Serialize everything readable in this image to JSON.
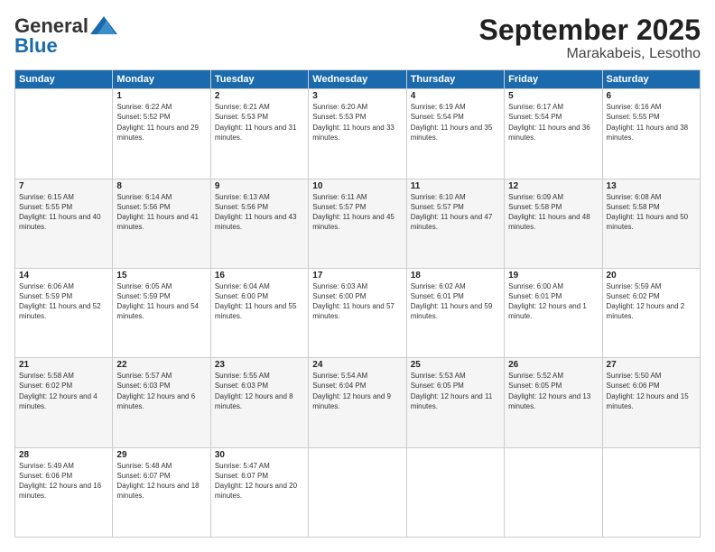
{
  "header": {
    "logo_general": "General",
    "logo_blue": "Blue",
    "month_title": "September 2025",
    "location": "Marakabeis, Lesotho"
  },
  "days_of_week": [
    "Sunday",
    "Monday",
    "Tuesday",
    "Wednesday",
    "Thursday",
    "Friday",
    "Saturday"
  ],
  "weeks": [
    [
      {
        "day": "",
        "sunrise": "",
        "sunset": "",
        "daylight": ""
      },
      {
        "day": "1",
        "sunrise": "Sunrise: 6:22 AM",
        "sunset": "Sunset: 5:52 PM",
        "daylight": "Daylight: 11 hours and 29 minutes."
      },
      {
        "day": "2",
        "sunrise": "Sunrise: 6:21 AM",
        "sunset": "Sunset: 5:53 PM",
        "daylight": "Daylight: 11 hours and 31 minutes."
      },
      {
        "day": "3",
        "sunrise": "Sunrise: 6:20 AM",
        "sunset": "Sunset: 5:53 PM",
        "daylight": "Daylight: 11 hours and 33 minutes."
      },
      {
        "day": "4",
        "sunrise": "Sunrise: 6:19 AM",
        "sunset": "Sunset: 5:54 PM",
        "daylight": "Daylight: 11 hours and 35 minutes."
      },
      {
        "day": "5",
        "sunrise": "Sunrise: 6:17 AM",
        "sunset": "Sunset: 5:54 PM",
        "daylight": "Daylight: 11 hours and 36 minutes."
      },
      {
        "day": "6",
        "sunrise": "Sunrise: 6:16 AM",
        "sunset": "Sunset: 5:55 PM",
        "daylight": "Daylight: 11 hours and 38 minutes."
      }
    ],
    [
      {
        "day": "7",
        "sunrise": "Sunrise: 6:15 AM",
        "sunset": "Sunset: 5:55 PM",
        "daylight": "Daylight: 11 hours and 40 minutes."
      },
      {
        "day": "8",
        "sunrise": "Sunrise: 6:14 AM",
        "sunset": "Sunset: 5:56 PM",
        "daylight": "Daylight: 11 hours and 41 minutes."
      },
      {
        "day": "9",
        "sunrise": "Sunrise: 6:13 AM",
        "sunset": "Sunset: 5:56 PM",
        "daylight": "Daylight: 11 hours and 43 minutes."
      },
      {
        "day": "10",
        "sunrise": "Sunrise: 6:11 AM",
        "sunset": "Sunset: 5:57 PM",
        "daylight": "Daylight: 11 hours and 45 minutes."
      },
      {
        "day": "11",
        "sunrise": "Sunrise: 6:10 AM",
        "sunset": "Sunset: 5:57 PM",
        "daylight": "Daylight: 11 hours and 47 minutes."
      },
      {
        "day": "12",
        "sunrise": "Sunrise: 6:09 AM",
        "sunset": "Sunset: 5:58 PM",
        "daylight": "Daylight: 11 hours and 48 minutes."
      },
      {
        "day": "13",
        "sunrise": "Sunrise: 6:08 AM",
        "sunset": "Sunset: 5:58 PM",
        "daylight": "Daylight: 11 hours and 50 minutes."
      }
    ],
    [
      {
        "day": "14",
        "sunrise": "Sunrise: 6:06 AM",
        "sunset": "Sunset: 5:59 PM",
        "daylight": "Daylight: 11 hours and 52 minutes."
      },
      {
        "day": "15",
        "sunrise": "Sunrise: 6:05 AM",
        "sunset": "Sunset: 5:59 PM",
        "daylight": "Daylight: 11 hours and 54 minutes."
      },
      {
        "day": "16",
        "sunrise": "Sunrise: 6:04 AM",
        "sunset": "Sunset: 6:00 PM",
        "daylight": "Daylight: 11 hours and 55 minutes."
      },
      {
        "day": "17",
        "sunrise": "Sunrise: 6:03 AM",
        "sunset": "Sunset: 6:00 PM",
        "daylight": "Daylight: 11 hours and 57 minutes."
      },
      {
        "day": "18",
        "sunrise": "Sunrise: 6:02 AM",
        "sunset": "Sunset: 6:01 PM",
        "daylight": "Daylight: 11 hours and 59 minutes."
      },
      {
        "day": "19",
        "sunrise": "Sunrise: 6:00 AM",
        "sunset": "Sunset: 6:01 PM",
        "daylight": "Daylight: 12 hours and 1 minute."
      },
      {
        "day": "20",
        "sunrise": "Sunrise: 5:59 AM",
        "sunset": "Sunset: 6:02 PM",
        "daylight": "Daylight: 12 hours and 2 minutes."
      }
    ],
    [
      {
        "day": "21",
        "sunrise": "Sunrise: 5:58 AM",
        "sunset": "Sunset: 6:02 PM",
        "daylight": "Daylight: 12 hours and 4 minutes."
      },
      {
        "day": "22",
        "sunrise": "Sunrise: 5:57 AM",
        "sunset": "Sunset: 6:03 PM",
        "daylight": "Daylight: 12 hours and 6 minutes."
      },
      {
        "day": "23",
        "sunrise": "Sunrise: 5:55 AM",
        "sunset": "Sunset: 6:03 PM",
        "daylight": "Daylight: 12 hours and 8 minutes."
      },
      {
        "day": "24",
        "sunrise": "Sunrise: 5:54 AM",
        "sunset": "Sunset: 6:04 PM",
        "daylight": "Daylight: 12 hours and 9 minutes."
      },
      {
        "day": "25",
        "sunrise": "Sunrise: 5:53 AM",
        "sunset": "Sunset: 6:05 PM",
        "daylight": "Daylight: 12 hours and 11 minutes."
      },
      {
        "day": "26",
        "sunrise": "Sunrise: 5:52 AM",
        "sunset": "Sunset: 6:05 PM",
        "daylight": "Daylight: 12 hours and 13 minutes."
      },
      {
        "day": "27",
        "sunrise": "Sunrise: 5:50 AM",
        "sunset": "Sunset: 6:06 PM",
        "daylight": "Daylight: 12 hours and 15 minutes."
      }
    ],
    [
      {
        "day": "28",
        "sunrise": "Sunrise: 5:49 AM",
        "sunset": "Sunset: 6:06 PM",
        "daylight": "Daylight: 12 hours and 16 minutes."
      },
      {
        "day": "29",
        "sunrise": "Sunrise: 5:48 AM",
        "sunset": "Sunset: 6:07 PM",
        "daylight": "Daylight: 12 hours and 18 minutes."
      },
      {
        "day": "30",
        "sunrise": "Sunrise: 5:47 AM",
        "sunset": "Sunset: 6:07 PM",
        "daylight": "Daylight: 12 hours and 20 minutes."
      },
      {
        "day": "",
        "sunrise": "",
        "sunset": "",
        "daylight": ""
      },
      {
        "day": "",
        "sunrise": "",
        "sunset": "",
        "daylight": ""
      },
      {
        "day": "",
        "sunrise": "",
        "sunset": "",
        "daylight": ""
      },
      {
        "day": "",
        "sunrise": "",
        "sunset": "",
        "daylight": ""
      }
    ]
  ]
}
